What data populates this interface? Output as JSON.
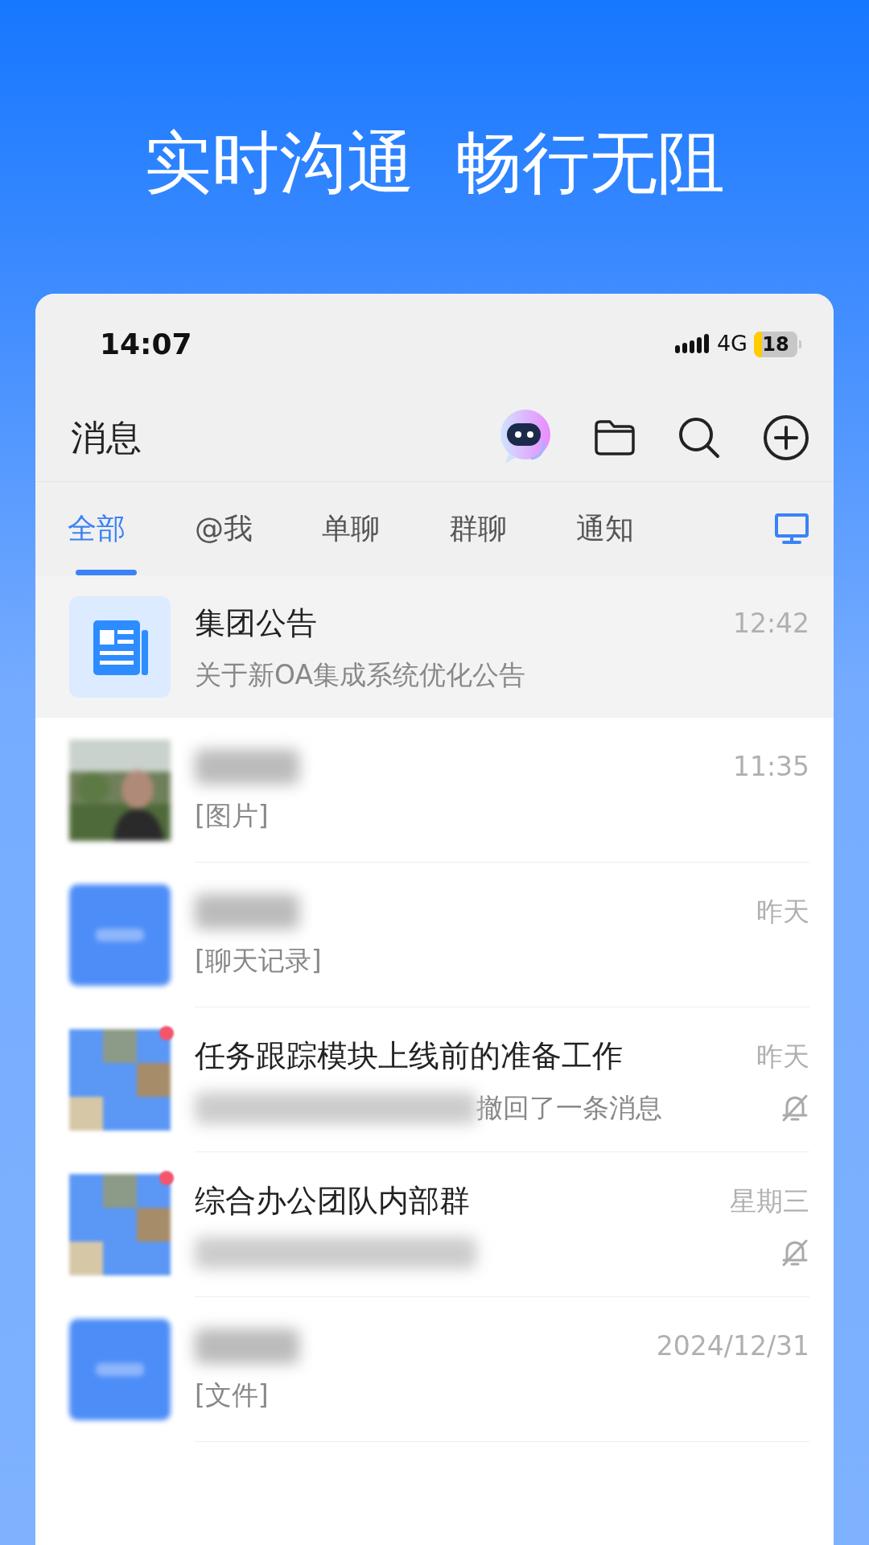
{
  "headline": [
    "实时沟通",
    "畅行无阻"
  ],
  "status_bar": {
    "time": "14:07",
    "network": "4G",
    "battery": "18"
  },
  "header": {
    "title": "消息"
  },
  "tabs": [
    {
      "label": "全部",
      "selected": true
    },
    {
      "label": "@我",
      "selected": false
    },
    {
      "label": "单聊",
      "selected": false
    },
    {
      "label": "群聊",
      "selected": false
    },
    {
      "label": "通知",
      "selected": false
    }
  ],
  "chats": [
    {
      "kind": "notice",
      "name": "集团公告",
      "name_hidden": false,
      "preview": "关于新OA集成系统优化公告",
      "preview_blurred": false,
      "time": "12:42",
      "muted": false,
      "unread": false,
      "selected": true
    },
    {
      "name_hidden": true,
      "preview": "[图片]",
      "preview_blurred": false,
      "time": "11:35",
      "muted": false,
      "unread": false,
      "selected": false
    },
    {
      "kind": "initials",
      "name_hidden": true,
      "preview": "[聊天记录]",
      "preview_blurred": false,
      "time": "昨天",
      "muted": false,
      "unread": false,
      "selected": false
    },
    {
      "kind": "group",
      "name": "任务跟踪模块上线前的准备工作",
      "name_hidden": false,
      "preview": "撤回了一条消息",
      "preview_blurred": true,
      "time": "昨天",
      "muted": true,
      "unread": true,
      "selected": false
    },
    {
      "kind": "group",
      "name": "综合办公团队内部群",
      "name_hidden": false,
      "preview_blurred": true,
      "time": "星期三",
      "muted": true,
      "unread": true,
      "selected": false
    },
    {
      "kind": "initials",
      "name_hidden": true,
      "preview": "[文件]",
      "preview_blurred": false,
      "time": "2024/12/31",
      "muted": false,
      "unread": false,
      "selected": false
    }
  ]
}
